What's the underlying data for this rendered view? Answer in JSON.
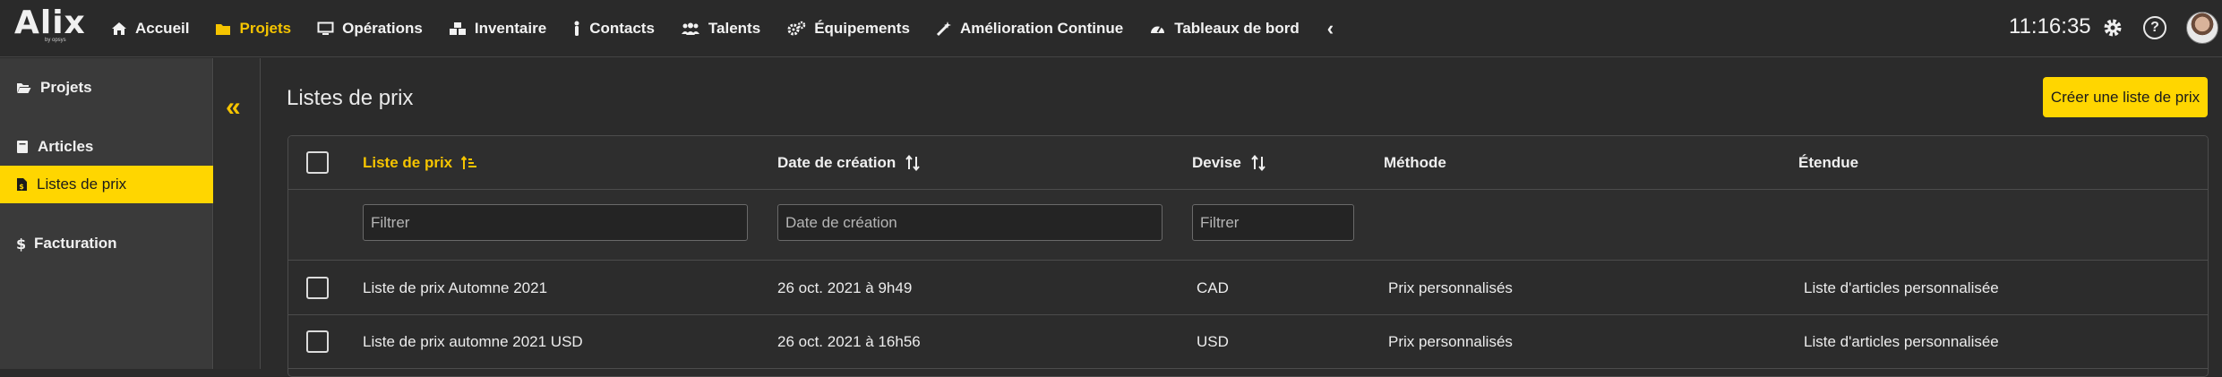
{
  "app": {
    "logo_text": "Alix",
    "logo_sub": "by opsys",
    "clock": "11:16:35",
    "help_label": "?"
  },
  "nav": {
    "items": [
      {
        "label": "Accueil",
        "icon": "home-icon",
        "active": false
      },
      {
        "label": "Projets",
        "icon": "folder-icon",
        "active": true
      },
      {
        "label": "Opérations",
        "icon": "monitor-icon",
        "active": false
      },
      {
        "label": "Inventaire",
        "icon": "boxes-icon",
        "active": false
      },
      {
        "label": "Contacts",
        "icon": "person-icon",
        "active": false
      },
      {
        "label": "Talents",
        "icon": "users-icon",
        "active": false
      },
      {
        "label": "Équipements",
        "icon": "gears-icon",
        "active": false
      },
      {
        "label": "Amélioration Continue",
        "icon": "magic-wand-icon",
        "active": false
      },
      {
        "label": "Tableaux de bord",
        "icon": "gauge-icon",
        "active": false
      }
    ],
    "collapse_glyph": "‹"
  },
  "sidebar": {
    "items": [
      {
        "label": "Projets",
        "icon": "folder-open-icon",
        "active": false
      },
      {
        "label": "Articles",
        "icon": "book-icon",
        "active": false
      },
      {
        "label": "Listes de prix",
        "icon": "file-price-icon",
        "active": true
      },
      {
        "label": "Facturation",
        "icon": "dollar-icon",
        "active": false
      }
    ],
    "toggle_glyph": "«"
  },
  "main": {
    "title": "Listes de prix",
    "create_button": "Créer une liste de prix"
  },
  "table": {
    "columns": [
      {
        "label": "Liste de prix",
        "sort": "asc-active"
      },
      {
        "label": "Date de création",
        "sort": "both"
      },
      {
        "label": "Devise",
        "sort": "both"
      },
      {
        "label": "Méthode",
        "sort": "none"
      },
      {
        "label": "Étendue",
        "sort": "none"
      }
    ],
    "filters": {
      "name_placeholder": "Filtrer",
      "date_placeholder": "Date de création",
      "currency_placeholder": "Filtrer"
    },
    "rows": [
      {
        "name": "Liste de prix Automne 2021",
        "date": "26 oct. 2021 à 9h49",
        "currency": "CAD",
        "method": "Prix personnalisés",
        "scope": "Liste d'articles personnalisée"
      },
      {
        "name": "Liste de prix automne 2021 USD",
        "date": "26 oct. 2021 à 16h56",
        "currency": "USD",
        "method": "Prix personnalisés",
        "scope": "Liste d'articles personnalisée"
      }
    ]
  },
  "colors": {
    "accent": "#ffd600",
    "accent_text": "#f5c400",
    "background": "#2b2b2b",
    "sidebar": "#3a3a3a"
  }
}
